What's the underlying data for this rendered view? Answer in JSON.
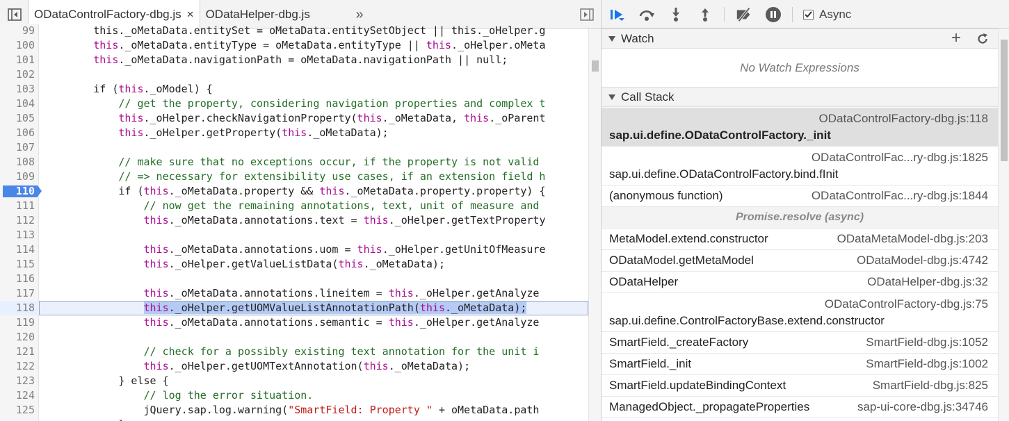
{
  "editor": {
    "tabs": [
      {
        "label": "ODataControlFactory-dbg.js",
        "active": true,
        "close": "×"
      },
      {
        "label": "ODataHelper-dbg.js",
        "active": false
      }
    ],
    "more_tabs_glyph": "»",
    "lines": [
      {
        "n": "99",
        "t": [
          [
            "p",
            "        this._oMetaData.entitySet = oMetaData.entitySetObject || this._oHelper.g"
          ]
        ]
      },
      {
        "n": "100",
        "t": [
          [
            "k",
            "        this"
          ],
          [
            "p",
            "._oMetaData.entityType = oMetaData.entityType || "
          ],
          [
            "k",
            "this"
          ],
          [
            "p",
            "._oHelper.oMeta"
          ]
        ]
      },
      {
        "n": "101",
        "t": [
          [
            "k",
            "        this"
          ],
          [
            "p",
            "._oMetaData.navigationPath = oMetaData.navigationPath || null;"
          ]
        ]
      },
      {
        "n": "102",
        "t": [
          [
            "p",
            ""
          ]
        ]
      },
      {
        "n": "103",
        "t": [
          [
            "p",
            "        if ("
          ],
          [
            "k",
            "this"
          ],
          [
            "p",
            "._oModel) {"
          ]
        ]
      },
      {
        "n": "104",
        "t": [
          [
            "c",
            "            // get the property, considering navigation properties and complex t"
          ]
        ]
      },
      {
        "n": "105",
        "t": [
          [
            "k",
            "            this"
          ],
          [
            "p",
            "._oHelper.checkNavigationProperty("
          ],
          [
            "k",
            "this"
          ],
          [
            "p",
            "._oMetaData, "
          ],
          [
            "k",
            "this"
          ],
          [
            "p",
            "._oParent"
          ]
        ]
      },
      {
        "n": "106",
        "t": [
          [
            "k",
            "            this"
          ],
          [
            "p",
            "._oHelper.getProperty("
          ],
          [
            "k",
            "this"
          ],
          [
            "p",
            "._oMetaData);"
          ]
        ]
      },
      {
        "n": "107",
        "t": [
          [
            "p",
            ""
          ]
        ]
      },
      {
        "n": "108",
        "t": [
          [
            "c",
            "            // make sure that no exceptions occur, if the property is not valid"
          ]
        ]
      },
      {
        "n": "109",
        "t": [
          [
            "c",
            "            // => necessary for extensibility use cases, if an extension field h"
          ]
        ]
      },
      {
        "n": "110",
        "bp": true,
        "t": [
          [
            "p",
            "            if ("
          ],
          [
            "k",
            "this"
          ],
          [
            "p",
            "._oMetaData.property && "
          ],
          [
            "k",
            "this"
          ],
          [
            "p",
            "._oMetaData.property.property) {"
          ]
        ]
      },
      {
        "n": "111",
        "t": [
          [
            "c",
            "                // now get the remaining annotations, text, unit of measure and"
          ]
        ]
      },
      {
        "n": "112",
        "t": [
          [
            "k",
            "                this"
          ],
          [
            "p",
            "._oMetaData.annotations.text = "
          ],
          [
            "k",
            "this"
          ],
          [
            "p",
            "._oHelper.getTextProperty"
          ]
        ]
      },
      {
        "n": "113",
        "t": [
          [
            "p",
            ""
          ]
        ]
      },
      {
        "n": "114",
        "t": [
          [
            "k",
            "                this"
          ],
          [
            "p",
            "._oMetaData.annotations.uom = "
          ],
          [
            "k",
            "this"
          ],
          [
            "p",
            "._oHelper.getUnitOfMeasure"
          ]
        ]
      },
      {
        "n": "115",
        "t": [
          [
            "k",
            "                this"
          ],
          [
            "p",
            "._oHelper.getValueListData("
          ],
          [
            "k",
            "this"
          ],
          [
            "p",
            "._oMetaData);"
          ]
        ]
      },
      {
        "n": "116",
        "t": [
          [
            "p",
            ""
          ]
        ]
      },
      {
        "n": "117",
        "t": [
          [
            "k",
            "                this"
          ],
          [
            "p",
            "._oMetaData.annotations.lineitem = "
          ],
          [
            "k",
            "this"
          ],
          [
            "p",
            "._oHelper.getAnalyze"
          ]
        ]
      },
      {
        "n": "118",
        "current": true,
        "t": [
          [
            "p",
            "                "
          ],
          [
            "k",
            "this"
          ],
          [
            "p",
            "._oHelper.getUOMValueListAnnotationPath("
          ],
          [
            "k",
            "this"
          ],
          [
            "p",
            "._oMetaData);"
          ]
        ]
      },
      {
        "n": "119",
        "t": [
          [
            "k",
            "                this"
          ],
          [
            "p",
            "._oMetaData.annotations.semantic = "
          ],
          [
            "k",
            "this"
          ],
          [
            "p",
            "._oHelper.getAnalyze"
          ]
        ]
      },
      {
        "n": "120",
        "t": [
          [
            "p",
            ""
          ]
        ]
      },
      {
        "n": "121",
        "t": [
          [
            "c",
            "                // check for a possibly existing text annotation for the unit i"
          ]
        ]
      },
      {
        "n": "122",
        "t": [
          [
            "k",
            "                this"
          ],
          [
            "p",
            "._oHelper.getUOMTextAnnotation("
          ],
          [
            "k",
            "this"
          ],
          [
            "p",
            "._oMetaData);"
          ]
        ]
      },
      {
        "n": "123",
        "t": [
          [
            "p",
            "            } else {"
          ]
        ]
      },
      {
        "n": "124",
        "t": [
          [
            "c",
            "                // log the error situation."
          ]
        ]
      },
      {
        "n": "125",
        "t": [
          [
            "p",
            "                jQuery.sap.log.warning("
          ],
          [
            "s",
            "\"SmartField: Property \""
          ],
          [
            "p",
            " + oMetaData.path"
          ]
        ]
      },
      {
        "n": "",
        "t": [
          [
            "p",
            "            }"
          ]
        ]
      }
    ]
  },
  "debugger": {
    "async_label": "Async",
    "async_checked": true,
    "watch": {
      "title": "Watch",
      "add_glyph": "+",
      "empty_text": "No Watch Expressions"
    },
    "call_stack": {
      "title": "Call Stack",
      "frames": [
        {
          "fn": "sap.ui.define.ODataControlFactory._init",
          "loc": "ODataControlFactory-dbg.js:118",
          "layout": "two",
          "selected": true
        },
        {
          "fn": "sap.ui.define.ODataControlFactory.bind.fInit",
          "loc": "ODataControlFac...ry-dbg.js:1825",
          "layout": "two"
        },
        {
          "fn": "(anonymous function)",
          "loc": "ODataControlFac...ry-dbg.js:1844",
          "layout": "one"
        },
        {
          "fn": "Promise.resolve (async)",
          "loc": "",
          "layout": "async"
        },
        {
          "fn": "MetaModel.extend.constructor",
          "loc": "ODataMetaModel-dbg.js:203",
          "layout": "one"
        },
        {
          "fn": "ODataModel.getMetaModel",
          "loc": "ODataModel-dbg.js:4742",
          "layout": "one"
        },
        {
          "fn": "ODataHelper",
          "loc": "ODataHelper-dbg.js:32",
          "layout": "one"
        },
        {
          "fn": "sap.ui.define.ControlFactoryBase.extend.constructor",
          "loc": "ODataControlFactory-dbg.js:75",
          "layout": "two"
        },
        {
          "fn": "SmartField._createFactory",
          "loc": "SmartField-dbg.js:1052",
          "layout": "one"
        },
        {
          "fn": "SmartField._init",
          "loc": "SmartField-dbg.js:1002",
          "layout": "one"
        },
        {
          "fn": "SmartField.updateBindingContext",
          "loc": "SmartField-dbg.js:825",
          "layout": "one"
        },
        {
          "fn": "ManagedObject._propagateProperties",
          "loc": "sap-ui-core-dbg.js:34746",
          "layout": "one"
        }
      ]
    },
    "toolbar_icons": [
      "resume-icon",
      "step-over-icon",
      "step-into-icon",
      "step-out-icon",
      "deactivate-breakpoints-icon",
      "pause-on-exceptions-icon"
    ]
  },
  "colors": {
    "accent": "#4a86e8",
    "keyword": "#aa0d91",
    "comment": "#236e25",
    "string": "#c41a16",
    "selection": "#b5cbf5"
  }
}
